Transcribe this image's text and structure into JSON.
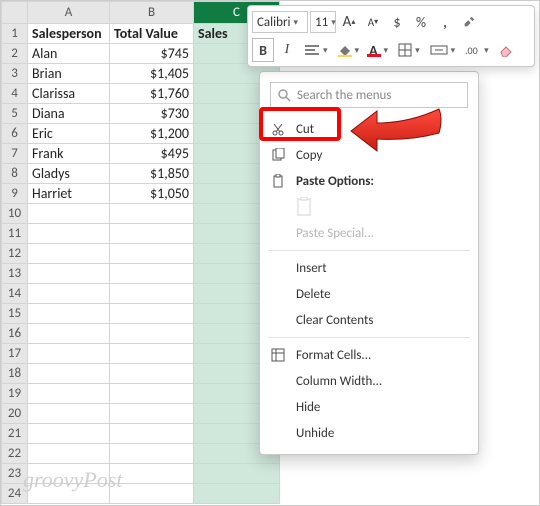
{
  "chart_data": {
    "type": "table",
    "columns": [
      "Salesperson",
      "Total Value"
    ],
    "rows": [
      [
        "Alan",
        745
      ],
      [
        "Brian",
        1405
      ],
      [
        "Clarissa",
        1760
      ],
      [
        "Diana",
        730
      ],
      [
        "Eric",
        1200
      ],
      [
        "Frank",
        495
      ],
      [
        "Gladys",
        1850
      ],
      [
        "Harriet",
        1050
      ]
    ]
  },
  "colheaders": {
    "A": "A",
    "B": "B",
    "C": "C"
  },
  "header": {
    "A": "Salesperson",
    "B": "Total Value",
    "C": "Sales"
  },
  "rows": [
    {
      "n": "2",
      "A": "Alan",
      "B": "$745"
    },
    {
      "n": "3",
      "A": "Brian",
      "B": "$1,405"
    },
    {
      "n": "4",
      "A": "Clarissa",
      "B": "$1,760"
    },
    {
      "n": "5",
      "A": "Diana",
      "B": "$730"
    },
    {
      "n": "6",
      "A": "Eric",
      "B": "$1,200"
    },
    {
      "n": "7",
      "A": "Frank",
      "B": "$495"
    },
    {
      "n": "8",
      "A": "Gladys",
      "B": "$1,850"
    },
    {
      "n": "9",
      "A": "Harriet",
      "B": "$1,050"
    }
  ],
  "blank_rows": [
    "10",
    "11",
    "12",
    "13",
    "14",
    "15",
    "16",
    "17",
    "18",
    "19",
    "20",
    "21",
    "22",
    "23",
    "24"
  ],
  "toolbar": {
    "font": "Calibri",
    "size": "11",
    "incfont": "A",
    "decfont": "A",
    "currency": "$",
    "percent": "%",
    "comma": ",",
    "bold": "B",
    "italic": "I"
  },
  "ctx": {
    "search_ph": "Search the menus",
    "cut": "Cut",
    "copy": "Copy",
    "paste_options": "Paste Options:",
    "paste_special": "Paste Special...",
    "insert": "Insert",
    "delete": "Delete",
    "clear": "Clear Contents",
    "format_cells": "Format Cells...",
    "col_width": "Column Width...",
    "hide": "Hide",
    "unhide": "Unhide"
  },
  "watermark": "groovyPost"
}
